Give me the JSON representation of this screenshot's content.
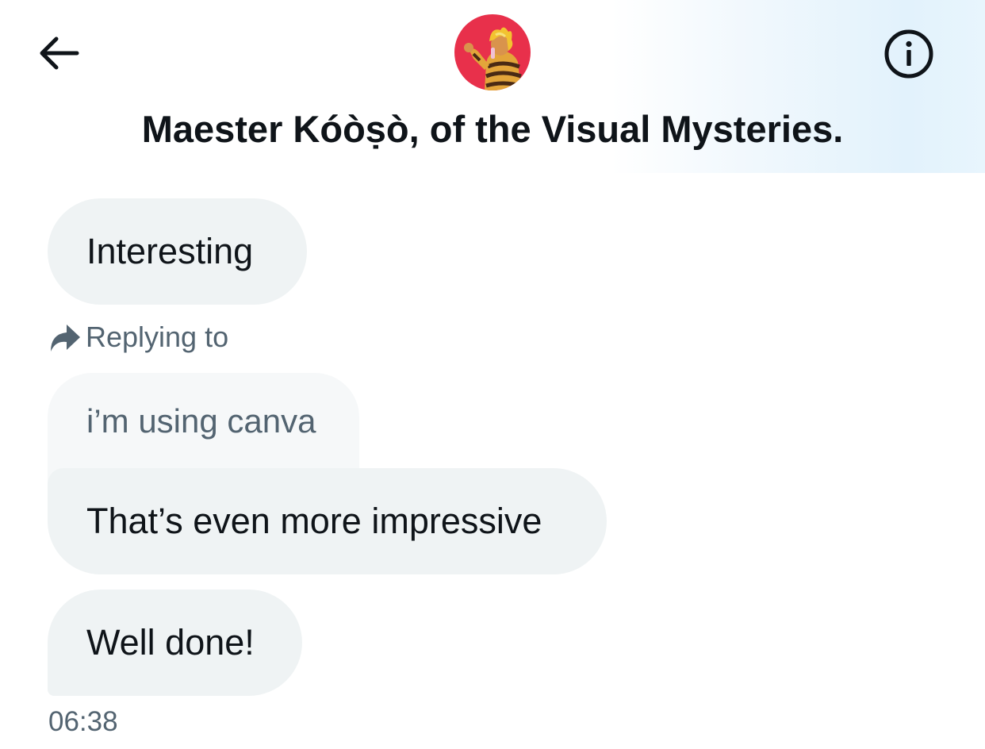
{
  "header": {
    "title": "Maester Kóòṣò, of the Visual Mysteries.",
    "back_icon": "arrow-left-icon",
    "info_icon": "info-circle-icon",
    "avatar_bg": "#e8304b"
  },
  "messages": [
    {
      "text": "Interesting"
    },
    {
      "reply_label": "Replying to",
      "quoted_text": "i’m using canva",
      "text": "That’s even more impressive"
    },
    {
      "text": "Well done!"
    }
  ],
  "timestamp": "06:38",
  "colors": {
    "bubble": "#eff3f4",
    "quoted_bubble": "#f6f8f9",
    "muted_text": "#536471",
    "primary_text": "#0f1419"
  }
}
